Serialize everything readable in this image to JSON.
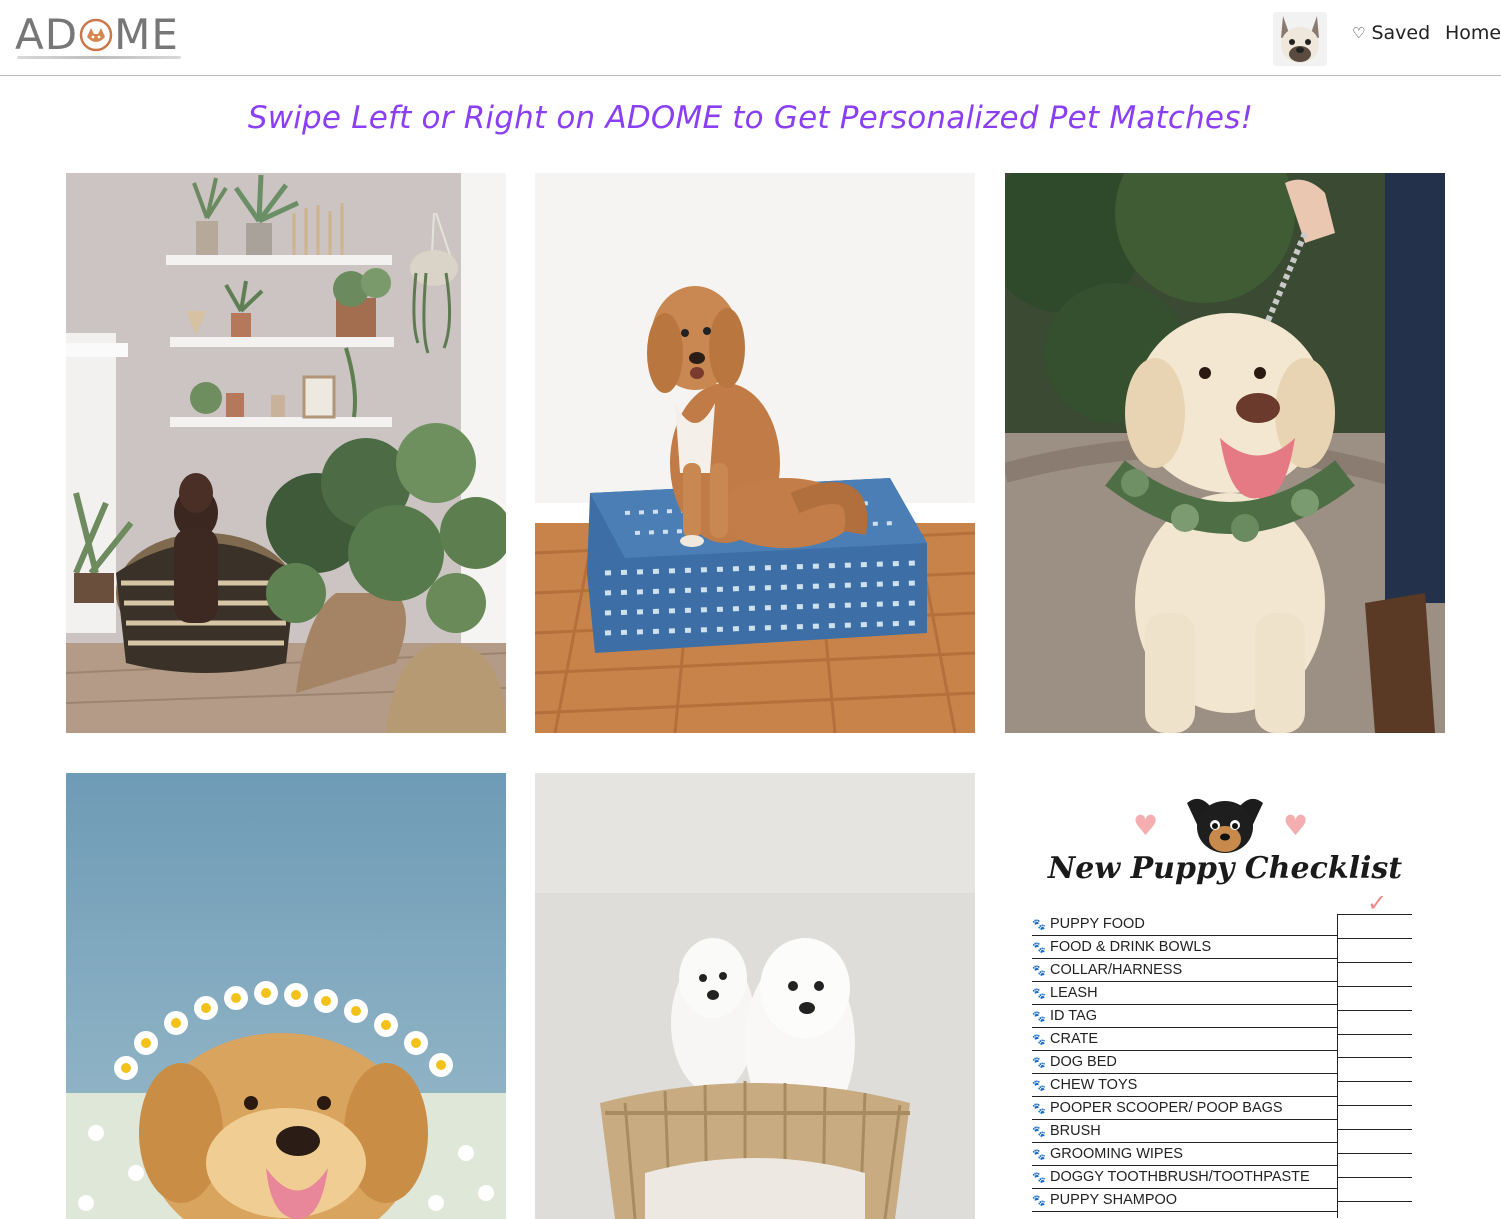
{
  "header": {
    "logo_text_left": "AD",
    "logo_text_right": "ME",
    "nav": {
      "saved_label": "Saved",
      "home_label": "Home"
    }
  },
  "tagline": "Swipe Left or Right on ADOME to Get Personalized Pet Matches!",
  "colors": {
    "tagline": "#8a3ff5",
    "header_border": "#b9b9b9",
    "checkmark": "#f28a8a"
  },
  "tiles": [
    {
      "subject": "dark dog in woven basket among houseplants"
    },
    {
      "subject": "curly brown dog on blue patterned cushion"
    },
    {
      "subject": "yellow labrador wearing leaf wreath on leash"
    },
    {
      "subject": "golden retriever with daisy crown"
    },
    {
      "subject": "two white fluffy dogs in wicker basket"
    }
  ],
  "checklist": {
    "title": "New Puppy Checklist",
    "items": [
      "PUPPY FOOD",
      "FOOD & DRINK BOWLS",
      "COLLAR/HARNESS",
      "LEASH",
      "ID TAG",
      "CRATE",
      "DOG BED",
      "CHEW TOYS",
      "POOPER SCOOPER/ POOP BAGS",
      "BRUSH",
      "GROOMING WIPES",
      "DOGGY TOOTHBRUSH/TOOTHPASTE",
      "PUPPY SHAMPOO"
    ],
    "check_glyph": "✓"
  }
}
